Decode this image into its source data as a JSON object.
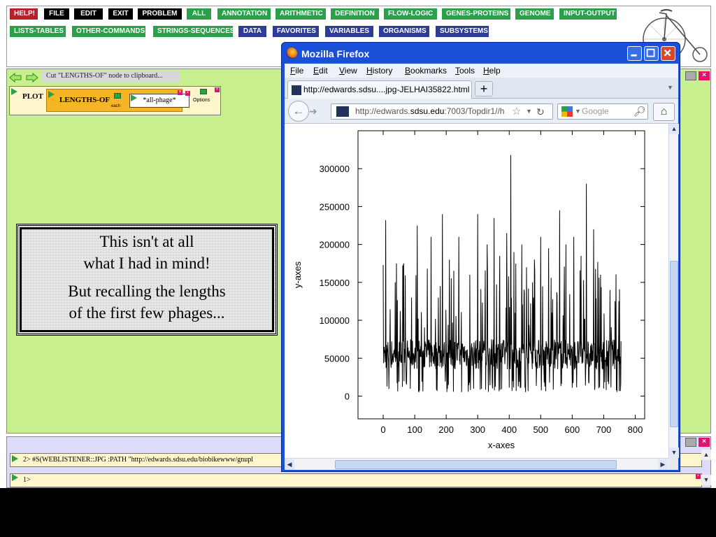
{
  "toolbar": {
    "rows": [
      [
        {
          "label": "HELP!",
          "color": "c"
        },
        {
          "label": "FILE",
          "color": "k"
        },
        {
          "label": "EDIT",
          "color": "k"
        },
        {
          "label": "EXIT",
          "color": "k"
        },
        {
          "label": "PROBLEM",
          "color": "k"
        },
        {
          "label": "ALL",
          "color": "g"
        },
        {
          "label": "ANNOTATION",
          "color": "g"
        },
        {
          "label": "ARITHMETIC",
          "color": "g"
        },
        {
          "label": "DEFINITION",
          "color": "g"
        },
        {
          "label": "FLOW-LOGIC",
          "color": "g"
        },
        {
          "label": "GENES-PROTEINS",
          "color": "g"
        },
        {
          "label": "GENOME",
          "color": "g"
        },
        {
          "label": "INPUT-OUTPUT",
          "color": "g"
        }
      ],
      [
        {
          "label": "LISTS-TABLES",
          "color": "g"
        },
        {
          "label": "OTHER-COMMANDS",
          "color": "g"
        },
        {
          "label": "STRINGS-SEQUENCES",
          "color": "g"
        },
        {
          "label": "DATA",
          "color": "b"
        },
        {
          "label": "FAVORITES",
          "color": "b"
        },
        {
          "label": "VARIABLES",
          "color": "b"
        },
        {
          "label": "ORGANISMS",
          "color": "b"
        },
        {
          "label": "SUBSYSTEMS",
          "color": "b"
        }
      ]
    ]
  },
  "workspace": {
    "clipboard_message": "Cut \"LENGTHS-OF\" node to clipboard...",
    "plot_label": "PLOT",
    "lengths_label": "LENGTHS-OF",
    "each_label": "each",
    "arg_value": "*all-phage*",
    "options_label": "Options",
    "note_line1": "This isn't at all",
    "note_line2": "what I had in mind!",
    "note_line3": "But recalling the lengths",
    "note_line4": "of the first few phages..."
  },
  "console": {
    "command": "2>  #S(WEBLISTENER::JPG :PATH \"http://edwards.sdsu.edu/biobikewww/gnupl",
    "prompt": "1>"
  },
  "firefox": {
    "title": "Mozilla Firefox",
    "menus": [
      "File",
      "Edit",
      "View",
      "History",
      "Bookmarks",
      "Tools",
      "Help"
    ],
    "tab_title": "http://edwards.sdsu....jpg-JELHAI35822.html",
    "new_tab": "+",
    "url_pre": "http://edwards.",
    "url_domain": "sdsu.edu",
    "url_post": ":7003/Topdir1//h",
    "search_placeholder": "Google"
  },
  "colors": {
    "workspace_bg": "#c9f08e",
    "console_bg": "#dcdcf8",
    "firefox_frame": "#1a4fd8",
    "help_red": "#b5222a",
    "menu_green": "#2aa04a",
    "menu_blue": "#2c3c98"
  },
  "chart_data": {
    "type": "line",
    "xlabel": "x-axes",
    "ylabel": "y-axes",
    "xlim": [
      -80,
      830
    ],
    "ylim": [
      -30000,
      350000
    ],
    "xticks": [
      0,
      100,
      200,
      300,
      400,
      500,
      600,
      700,
      800
    ],
    "yticks": [
      0,
      50000,
      100000,
      150000,
      200000,
      250000,
      300000
    ],
    "grid": false,
    "series": [
      {
        "x_range": [
          0,
          755
        ],
        "baseline": 50000,
        "spikes": [
          {
            "x": 8,
            "y": 232000
          },
          {
            "x": 38,
            "y": 150000
          },
          {
            "x": 42,
            "y": 175000
          },
          {
            "x": 65,
            "y": 175000
          },
          {
            "x": 90,
            "y": 130000
          },
          {
            "x": 108,
            "y": 225000
          },
          {
            "x": 140,
            "y": 168000
          },
          {
            "x": 152,
            "y": 210000
          },
          {
            "x": 175,
            "y": 130000
          },
          {
            "x": 188,
            "y": 240000
          },
          {
            "x": 210,
            "y": 180000
          },
          {
            "x": 240,
            "y": 210000
          },
          {
            "x": 275,
            "y": 160000
          },
          {
            "x": 300,
            "y": 240000
          },
          {
            "x": 330,
            "y": 200000
          },
          {
            "x": 352,
            "y": 235000
          },
          {
            "x": 370,
            "y": 185000
          },
          {
            "x": 392,
            "y": 215000
          },
          {
            "x": 405,
            "y": 318000
          },
          {
            "x": 415,
            "y": 190000
          },
          {
            "x": 440,
            "y": 200000
          },
          {
            "x": 455,
            "y": 170000
          },
          {
            "x": 480,
            "y": 180000
          },
          {
            "x": 500,
            "y": 210000
          },
          {
            "x": 525,
            "y": 195000
          },
          {
            "x": 560,
            "y": 245000
          },
          {
            "x": 580,
            "y": 200000
          },
          {
            "x": 605,
            "y": 210000
          },
          {
            "x": 628,
            "y": 185000
          },
          {
            "x": 645,
            "y": 280000
          },
          {
            "x": 668,
            "y": 220000
          },
          {
            "x": 690,
            "y": 160000
          },
          {
            "x": 720,
            "y": 140000
          },
          {
            "x": 748,
            "y": 125000
          }
        ]
      }
    ]
  }
}
